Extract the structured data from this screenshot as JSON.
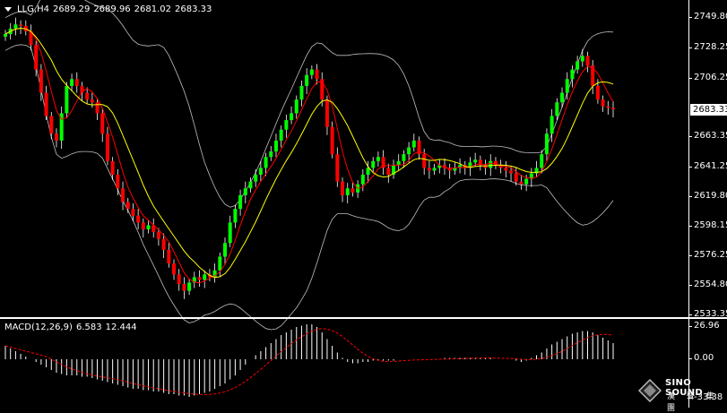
{
  "header": {
    "symbol": "LLG,H4",
    "open": "2689.29",
    "high": "2689.96",
    "low": "2681.02",
    "close": "2683.33"
  },
  "price_axis": {
    "ticks": [
      "2749.80",
      "2728.25",
      "2706.25",
      "2685.00",
      "2663.35",
      "2641.25",
      "2619.80",
      "2598.15",
      "2576.25",
      "2554.80",
      "2533.35"
    ],
    "current_price": "2683.33"
  },
  "macd": {
    "label": "MACD(12,26,9)",
    "value": "6.583",
    "signal": "12.444",
    "axis_ticks": [
      "26.96",
      "0.00",
      "-33.38"
    ]
  },
  "watermark": {
    "brand": "SINO SOUND",
    "sub": "漢 聲 集 團"
  },
  "colors": {
    "background": "#000000",
    "bull_candle": "#00ff00",
    "bear_candle": "#ff0000",
    "ma_fast": "#ff0000",
    "ma_slow": "#ffff00",
    "bollinger": "#c0c0c0",
    "macd_hist": "#ffffff",
    "macd_signal": "#ff0000"
  },
  "chart_data": {
    "type": "candlestick",
    "symbol": "LLG,H4",
    "ylim": [
      2533.35,
      2749.8
    ],
    "indicators": [
      "MA fast (red)",
      "MA slow (yellow)",
      "Bollinger Bands (gray)",
      "MACD(12,26,9)"
    ],
    "close_series": [
      2738,
      2742,
      2745,
      2744,
      2740,
      2730,
      2712,
      2695,
      2678,
      2665,
      2660,
      2680,
      2700,
      2705,
      2700,
      2695,
      2690,
      2688,
      2680,
      2665,
      2645,
      2635,
      2625,
      2615,
      2610,
      2605,
      2600,
      2595,
      2598,
      2593,
      2588,
      2580,
      2570,
      2562,
      2555,
      2550,
      2556,
      2560,
      2558,
      2562,
      2560,
      2565,
      2575,
      2585,
      2600,
      2610,
      2620,
      2625,
      2630,
      2635,
      2640,
      2648,
      2652,
      2660,
      2668,
      2675,
      2680,
      2690,
      2700,
      2708,
      2712,
      2705,
      2690,
      2670,
      2650,
      2630,
      2620,
      2625,
      2622,
      2628,
      2635,
      2640,
      2645,
      2648,
      2640,
      2635,
      2642,
      2645,
      2650,
      2655,
      2660,
      2650,
      2640,
      2638,
      2640,
      2642,
      2640,
      2638,
      2640,
      2642,
      2640,
      2644,
      2646,
      2642,
      2640,
      2645,
      2642,
      2640,
      2638,
      2636,
      2630,
      2628,
      2632,
      2636,
      2640,
      2650,
      2665,
      2678,
      2688,
      2695,
      2705,
      2712,
      2718,
      2722,
      2715,
      2700,
      2690,
      2685,
      2684,
      2683
    ],
    "macd_hist": [
      10,
      8,
      6,
      4,
      2,
      0,
      -2,
      -4,
      -6,
      -8,
      -10,
      -11,
      -12,
      -12,
      -12,
      -13,
      -13,
      -14,
      -15,
      -16,
      -17,
      -18,
      -19,
      -20,
      -21,
      -22,
      -22,
      -23,
      -23,
      -24,
      -24,
      -25,
      -26,
      -26,
      -27,
      -27,
      -28,
      -27,
      -26,
      -25,
      -24,
      -22,
      -20,
      -18,
      -15,
      -12,
      -8,
      -4,
      0,
      3,
      6,
      9,
      12,
      15,
      18,
      20,
      22,
      24,
      25,
      26,
      26,
      24,
      20,
      15,
      10,
      5,
      1,
      -2,
      -3,
      -3,
      -2,
      -2,
      -1,
      -1,
      -1,
      -1,
      -1,
      0,
      0,
      0,
      0,
      0,
      0,
      0,
      0,
      0,
      1,
      1,
      1,
      1,
      1,
      1,
      1,
      1,
      1,
      1,
      0,
      0,
      0,
      0,
      -1,
      -2,
      -1,
      1,
      3,
      5,
      8,
      11,
      13,
      15,
      17,
      19,
      20,
      21,
      21,
      20,
      18,
      16,
      14,
      12
    ],
    "macd_value": 6.583,
    "macd_signal_value": 12.444
  }
}
